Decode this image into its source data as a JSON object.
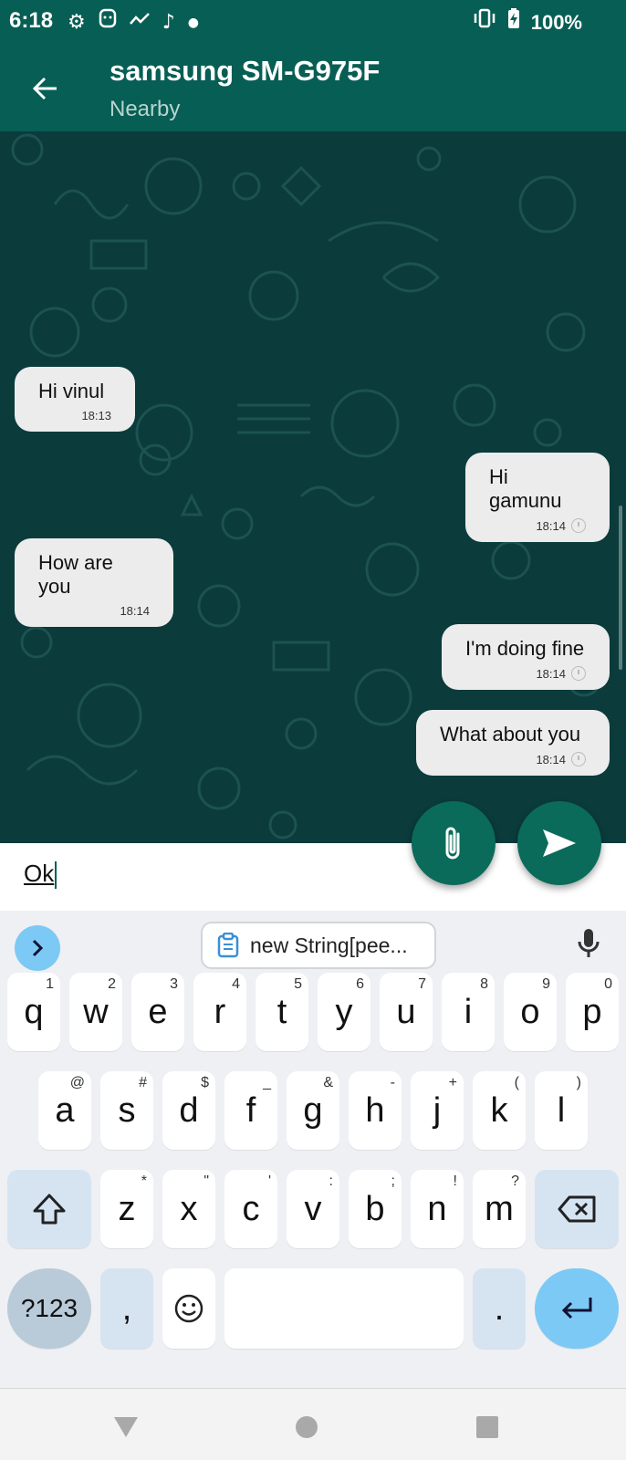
{
  "status_bar": {
    "time": "6:18",
    "battery": "100%",
    "left_icons": [
      "gear-icon",
      "face-icon",
      "activity-icon",
      "music-note-icon",
      "dot-icon"
    ],
    "right_icons": [
      "vibrate-icon",
      "battery-charging-icon"
    ]
  },
  "app_bar": {
    "title": "samsung SM-G975F",
    "subtitle": "Nearby"
  },
  "messages": [
    {
      "text": "Hi vinul",
      "time": "18:13",
      "direction": "incoming"
    },
    {
      "text": "Hi gamunu",
      "time": "18:14",
      "direction": "outgoing",
      "status": "pending-clock-icon"
    },
    {
      "text": "How are you",
      "time": "18:14",
      "direction": "incoming"
    },
    {
      "text": "I'm doing fine",
      "time": "18:14",
      "direction": "outgoing",
      "status": "pending-clock-icon"
    },
    {
      "text": "What about you",
      "time": "18:14",
      "direction": "outgoing",
      "status": "pending-clock-icon"
    }
  ],
  "input": {
    "value": "Ok"
  },
  "keyboard": {
    "suggestion_chip": "new String[pee...",
    "row1": [
      {
        "key": "q",
        "hint": "1"
      },
      {
        "key": "w",
        "hint": "2"
      },
      {
        "key": "e",
        "hint": "3"
      },
      {
        "key": "r",
        "hint": "4"
      },
      {
        "key": "t",
        "hint": "5"
      },
      {
        "key": "y",
        "hint": "6"
      },
      {
        "key": "u",
        "hint": "7"
      },
      {
        "key": "i",
        "hint": "8"
      },
      {
        "key": "o",
        "hint": "9"
      },
      {
        "key": "p",
        "hint": "0"
      }
    ],
    "row2": [
      {
        "key": "a",
        "hint": "@"
      },
      {
        "key": "s",
        "hint": "#"
      },
      {
        "key": "d",
        "hint": "$"
      },
      {
        "key": "f",
        "hint": "_"
      },
      {
        "key": "g",
        "hint": "&"
      },
      {
        "key": "h",
        "hint": "-"
      },
      {
        "key": "j",
        "hint": "+"
      },
      {
        "key": "k",
        "hint": "("
      },
      {
        "key": "l",
        "hint": ")"
      }
    ],
    "row3": [
      {
        "key": "z",
        "hint": "*"
      },
      {
        "key": "x",
        "hint": "\""
      },
      {
        "key": "c",
        "hint": "'"
      },
      {
        "key": "v",
        "hint": ":"
      },
      {
        "key": "b",
        "hint": ";"
      },
      {
        "key": "n",
        "hint": "!"
      },
      {
        "key": "m",
        "hint": "?"
      }
    ],
    "symbols_key": "?123",
    "comma_key": ",",
    "period_key": "."
  },
  "colors": {
    "header": "#075e54",
    "chat_background": "#0b3b3b",
    "bubble": "#ececec",
    "fab": "#0a6b5a",
    "key_special": "#d6e4f2",
    "accent_blue": "#7cc9f5"
  }
}
